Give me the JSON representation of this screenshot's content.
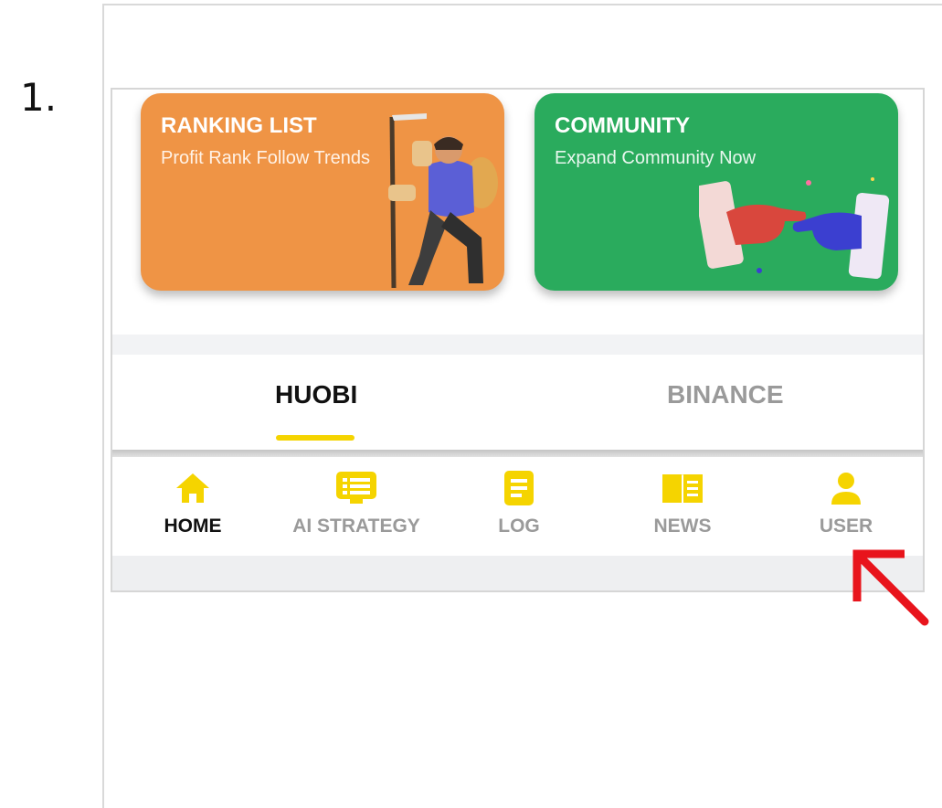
{
  "step": {
    "number": "1."
  },
  "cards": {
    "ranking": {
      "title": "RANKING LIST",
      "subtitle": "Profit Rank Follow Trends"
    },
    "community": {
      "title": "COMMUNITY",
      "subtitle": "Expand Community Now"
    }
  },
  "exchange_tabs": [
    {
      "label": "HUOBI",
      "selected": true
    },
    {
      "label": "BINANCE",
      "selected": false
    }
  ],
  "bottom_nav": [
    {
      "label": "HOME",
      "icon": "home-icon",
      "active": true
    },
    {
      "label": "AI STRATEGY",
      "icon": "strategy-icon",
      "active": false
    },
    {
      "label": "LOG",
      "icon": "log-icon",
      "active": false
    },
    {
      "label": "NEWS",
      "icon": "news-icon",
      "active": false
    },
    {
      "label": "USER",
      "icon": "user-icon",
      "active": false
    }
  ],
  "colors": {
    "accent_yellow": "#f5d400",
    "ranking_card": "#ef9445",
    "community_card": "#2aab5d",
    "annotation_arrow": "#e8141c"
  }
}
